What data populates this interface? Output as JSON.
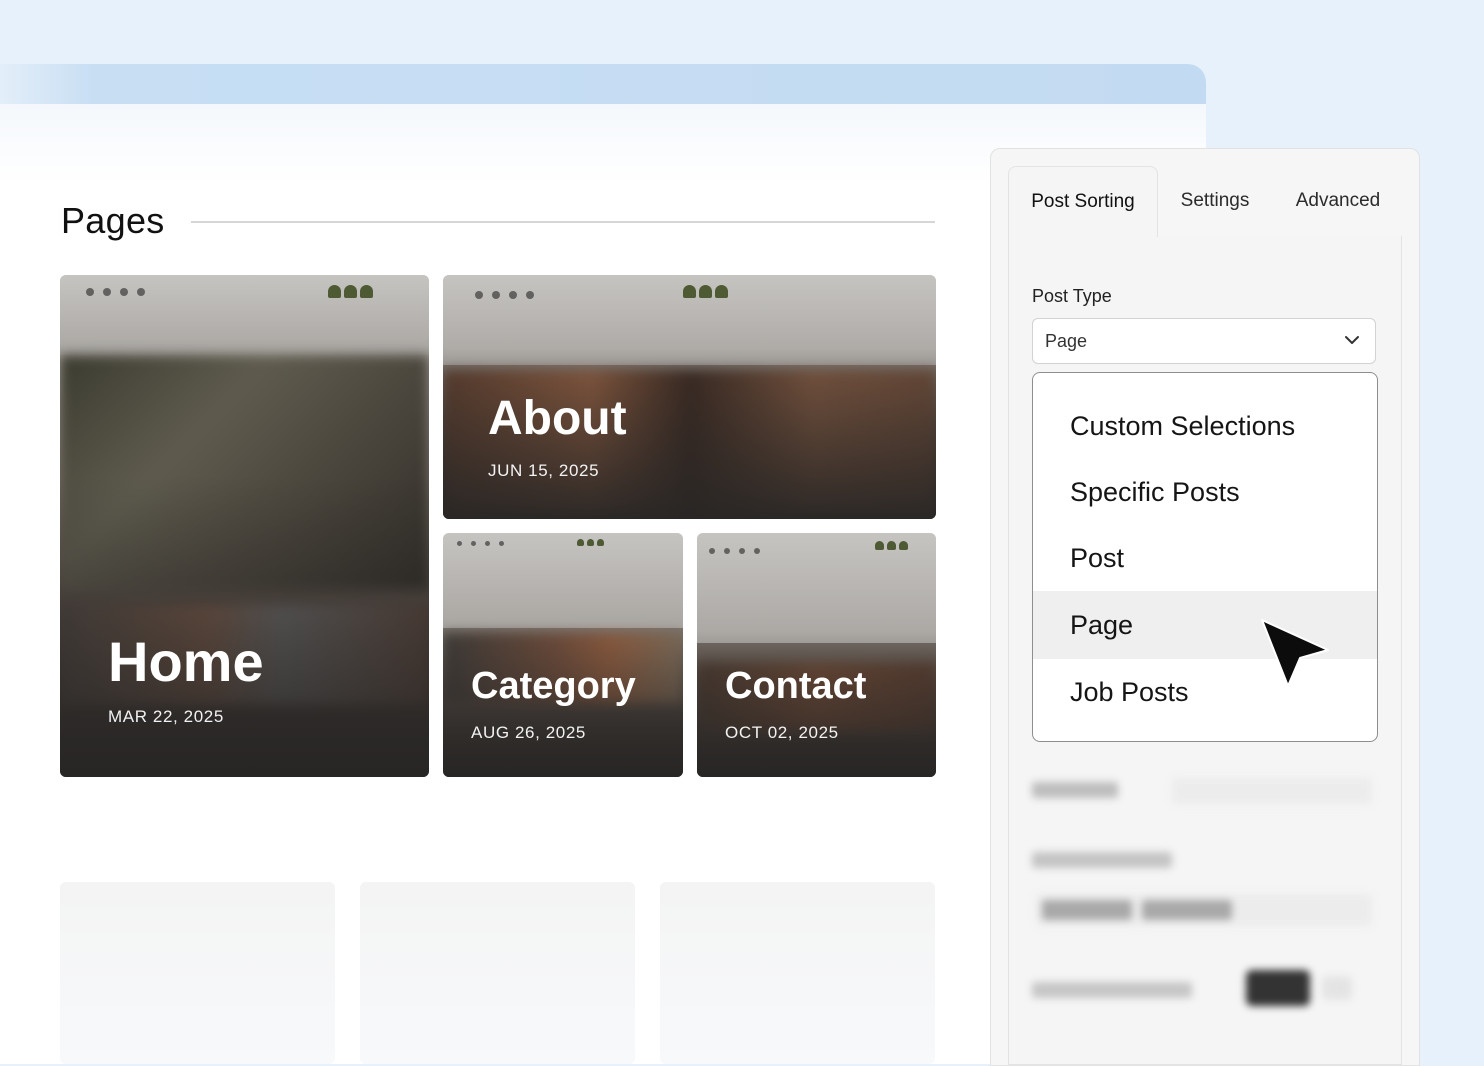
{
  "pages_section": {
    "title": "Pages",
    "cards": [
      {
        "title": "Home",
        "date": "MAR 22, 2025"
      },
      {
        "title": "About",
        "date": "JUN 15, 2025"
      },
      {
        "title": "Category",
        "date": "AUG 26, 2025"
      },
      {
        "title": "Contact",
        "date": "OCT 02, 2025"
      }
    ]
  },
  "settings_panel": {
    "tabs": [
      {
        "label": "Post Sorting",
        "active": true
      },
      {
        "label": "Settings",
        "active": false
      },
      {
        "label": "Advanced",
        "active": false
      }
    ],
    "post_type": {
      "label": "Post Type",
      "value": "Page",
      "options": [
        {
          "label": "Custom Selections",
          "selected": false
        },
        {
          "label": "Specific Posts",
          "selected": false
        },
        {
          "label": "Post",
          "selected": false
        },
        {
          "label": "Page",
          "selected": true
        },
        {
          "label": "Job Posts",
          "selected": false
        }
      ]
    }
  },
  "icons": {
    "select_chevron": "chevron-down-icon",
    "pointer": "cursor-arrow-icon"
  },
  "colors": {
    "page_background": "#e6f1fb",
    "browser_bar": "#c3dbf2",
    "logo_green": "#4d5a34",
    "panel_background": "#f5f5f5"
  }
}
